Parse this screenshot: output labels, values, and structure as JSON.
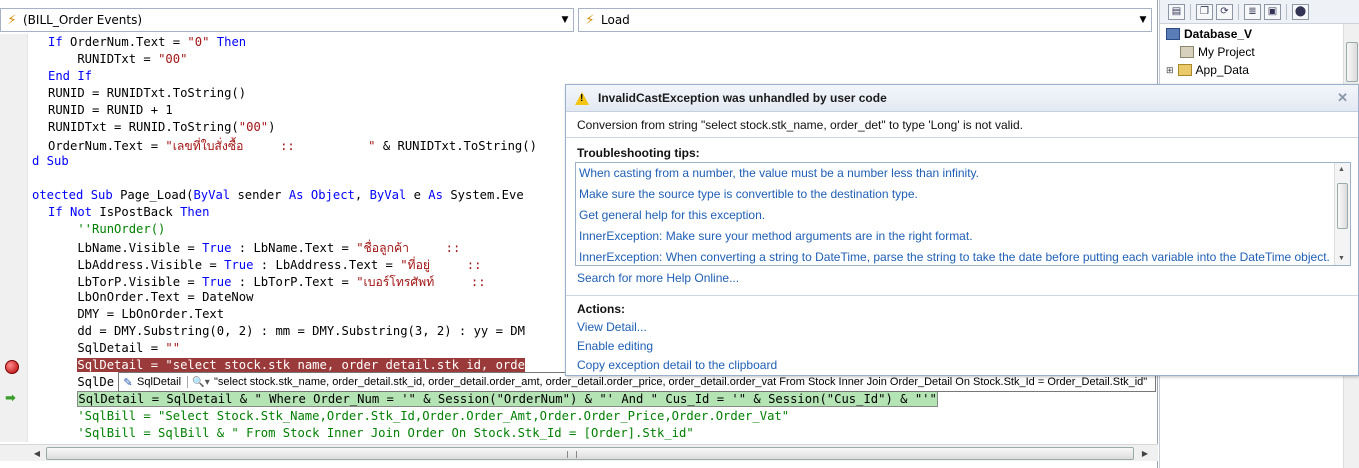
{
  "editor": {
    "left_combo": "(BILL_Order Events)",
    "right_combo": "Load"
  },
  "code_lines": [
    [
      [
        "kw",
        "If "
      ],
      [
        "t",
        "OrderNum.Text = "
      ],
      [
        "str",
        "\"0\""
      ],
      [
        "kw",
        " Then"
      ]
    ],
    [
      [
        "t",
        "    RUNIDTxt = "
      ],
      [
        "str",
        "\"00\""
      ]
    ],
    [
      [
        "kw",
        "End If"
      ]
    ],
    [
      [
        "t",
        "RUNID = RUNIDTxt.ToString()"
      ]
    ],
    [
      [
        "t",
        "RUNID = RUNID + 1"
      ]
    ],
    [
      [
        "t",
        "RUNIDTxt = RUNID.ToString("
      ],
      [
        "str",
        "\"00\""
      ],
      [
        "t",
        ")"
      ]
    ],
    [
      [
        "t",
        "OrderNum.Text = "
      ],
      [
        "str",
        "\"เลขที่ใบสั่งซื้อ     ::          \""
      ],
      [
        "t",
        " & RUNIDTxt.ToString()"
      ]
    ],
    [
      [
        "kw",
        "d Sub"
      ]
    ],
    [
      [
        "t",
        ""
      ]
    ],
    [
      [
        "kw",
        "otected Sub "
      ],
      [
        "t",
        "Page_Load("
      ],
      [
        "kw",
        "ByVal "
      ],
      [
        "t",
        "sender "
      ],
      [
        "kw",
        "As Object"
      ],
      [
        "t",
        ", "
      ],
      [
        "kw",
        "ByVal "
      ],
      [
        "t",
        "e "
      ],
      [
        "kw",
        "As "
      ],
      [
        "t",
        "System.Eve"
      ]
    ],
    [
      [
        "kw",
        "If Not "
      ],
      [
        "t",
        "IsPostBack "
      ],
      [
        "kw",
        "Then"
      ]
    ],
    [
      [
        "cmt",
        "    ''RunOrder()"
      ]
    ],
    [
      [
        "t",
        "    LbName.Visible = "
      ],
      [
        "kw",
        "True"
      ],
      [
        "t",
        " : LbName.Text = "
      ],
      [
        "str",
        "\"ชื่อลูกค้า     ::"
      ]
    ],
    [
      [
        "t",
        "    LbAddress.Visible = "
      ],
      [
        "kw",
        "True"
      ],
      [
        "t",
        " : LbAddress.Text = "
      ],
      [
        "str",
        "\"ที่อยู่     ::"
      ]
    ],
    [
      [
        "t",
        "    LbTorP.Visible = "
      ],
      [
        "kw",
        "True"
      ],
      [
        "t",
        " : LbTorP.Text = "
      ],
      [
        "str",
        "\"เบอร์โทรศัพท์     ::"
      ]
    ],
    [
      [
        "t",
        "    LbOnOrder.Text = DateNow"
      ]
    ],
    [
      [
        "t",
        "    DMY = LbOnOrder.Text"
      ]
    ],
    [
      [
        "t",
        "    dd = DMY.Substring(0, 2) : mm = DMY.Substring(3, 2) : yy = DM"
      ]
    ],
    [
      [
        "t",
        "    SqlDetail = "
      ],
      [
        "str",
        "\"\""
      ]
    ],
    [
      [
        "t",
        "    "
      ],
      [
        "hlr",
        "SqlDetail = \"select stock.stk name, order detail.stk id, orde"
      ]
    ],
    [
      [
        "t",
        "    SqlDe"
      ]
    ],
    [
      [
        "t",
        "    "
      ],
      [
        "hlg",
        "SqlDetail = SqlDetail & \" Where Order_Num = '\" & Session(\"OrderNum\") & \"' And \" Cus_Id = '\" & Session(\"Cus_Id\") & \"'\""
      ]
    ],
    [
      [
        "cmt",
        "    'SqlBill = \"Select Stock.Stk_Name,Order.Stk_Id,Order.Order_Amt,Order.Order_Price,Order.Order_Vat\""
      ]
    ],
    [
      [
        "cmt",
        "    'SqlBill = SqlBill & \" From Stock Inner Join Order On Stock.Stk_Id = [Order].Stk_id\""
      ]
    ]
  ],
  "datatip": {
    "name": "SqlDetail",
    "value": "\"select stock.stk_name, order_detail.stk_id, order_detail.order_amt, order_detail.order_price, order_detail.order_vat From Stock Inner Join Order_Detail On Stock.Stk_Id = Order_Detail.Stk_id\""
  },
  "exception": {
    "title": "InvalidCastException was unhandled by user code",
    "message": "Conversion from string \"select stock.stk_name, order_det\" to type 'Long' is not valid.",
    "tips_header": "Troubleshooting tips:",
    "tips": [
      "When casting from a number, the value must be a number less than infinity.",
      "Make sure the source type is convertible to the destination type.",
      "Get general help for this exception.",
      "InnerException: Make sure your method arguments are in the right format.",
      "InnerException: When converting a string to DateTime, parse the string to take the date before putting each variable into the DateTime object."
    ],
    "search_link": "Search for more Help Online...",
    "actions_header": "Actions:",
    "actions": [
      "View Detail...",
      "Enable editing",
      "Copy exception detail to the clipboard"
    ]
  },
  "solution": {
    "root": "Database_V",
    "items": [
      "My Project",
      "App_Data"
    ]
  },
  "colors": {
    "keyword": "#0000ff",
    "string": "#a31515",
    "comment": "#008000",
    "error_highlight": "#9b3a3a",
    "current_line": "#b4e3b4",
    "link": "#1f5fb5"
  }
}
